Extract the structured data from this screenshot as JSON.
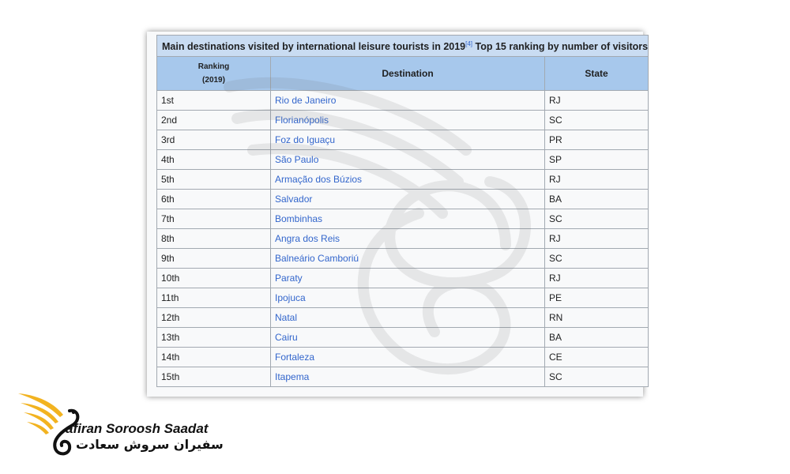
{
  "table": {
    "caption_main": "Main destinations visited by international leisure tourists in 2019",
    "caption_ref": "[4]",
    "caption_rest": " Top 15 ranking by number of visitors",
    "headers": {
      "ranking_line1": "Ranking",
      "ranking_line2": "(2019)",
      "destination": "Destination",
      "state": "State"
    },
    "rows": [
      {
        "rank": "1st",
        "destination": "Rio de Janeiro",
        "state": "RJ"
      },
      {
        "rank": "2nd",
        "destination": "Florianópolis",
        "state": "SC"
      },
      {
        "rank": "3rd",
        "destination": "Foz do Iguaçu",
        "state": "PR"
      },
      {
        "rank": "4th",
        "destination": "São Paulo",
        "state": "SP"
      },
      {
        "rank": "5th",
        "destination": "Armação dos Búzios",
        "state": "RJ"
      },
      {
        "rank": "6th",
        "destination": "Salvador",
        "state": "BA"
      },
      {
        "rank": "7th",
        "destination": "Bombinhas",
        "state": "SC"
      },
      {
        "rank": "8th",
        "destination": "Angra dos Reis",
        "state": "RJ"
      },
      {
        "rank": "9th",
        "destination": "Balneário Camboriú",
        "state": "SC"
      },
      {
        "rank": "10th",
        "destination": "Paraty",
        "state": "RJ"
      },
      {
        "rank": "11th",
        "destination": "Ipojuca",
        "state": "PE"
      },
      {
        "rank": "12th",
        "destination": "Natal",
        "state": "RN"
      },
      {
        "rank": "13th",
        "destination": "Cairu",
        "state": "BA"
      },
      {
        "rank": "14th",
        "destination": "Fortaleza",
        "state": "CE"
      },
      {
        "rank": "15th",
        "destination": "Itapema",
        "state": "SC"
      }
    ]
  },
  "brand": {
    "name_en": "afiran Soroosh Saadat",
    "name_fa": "سفیران سروش سعادت"
  },
  "colors": {
    "caption_bg": "#c9dcf2",
    "header_bg": "#a7c8ec",
    "link": "#3366cc",
    "logo_gold": "#f2b320"
  }
}
